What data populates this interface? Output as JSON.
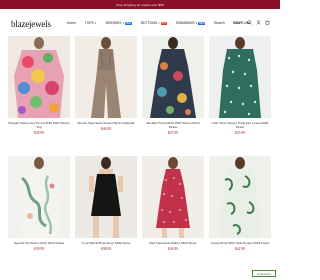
{
  "announcement": "Free shipping on orders over $59",
  "logo": "blazejewels",
  "nav": [
    {
      "label": "Home",
      "caret": false,
      "tag": ""
    },
    {
      "label": "TOPS",
      "caret": true,
      "tag": ""
    },
    {
      "label": "DRESSES",
      "caret": true,
      "tag": "NEW"
    },
    {
      "label": "BOTTOMS",
      "caret": true,
      "tag": "HOT"
    },
    {
      "label": "SWIMWEAR",
      "caret": true,
      "tag": "NEW"
    },
    {
      "label": "Search",
      "caret": false,
      "tag": ""
    },
    {
      "label": "Short Links",
      "caret": false,
      "tag": ""
    }
  ],
  "currency": "USD",
  "products": [
    {
      "title": "Elegant Watercolor Floral Print Half Sleeve Top",
      "price": "$38.99",
      "img": "p1"
    },
    {
      "title": "Brown Sleeveless Round Neck Jumpsuit",
      "price": "$46.99",
      "img": "p2"
    },
    {
      "title": "Modern Floral Print Half Sleeve Maxi Dress",
      "price": "$47.99",
      "img": "p3"
    },
    {
      "title": "Chic Short Sleeve Wide Dot Green Midi Dress",
      "price": "$45.99",
      "img": "p4"
    },
    {
      "title": "Special Tri-Sleeve Print Maxi Dress",
      "price": "$39.99",
      "img": "p5"
    },
    {
      "title": "Cool Black Plain Strap Mini Dress",
      "price": "$38.99",
      "img": "p6"
    },
    {
      "title": "Red Sleeveless Halter Midi Dress",
      "price": "$36.99",
      "img": "p7"
    },
    {
      "title": "Green Plant Print Side Pocket Midi Dress",
      "price": "$42.99",
      "img": "p8"
    }
  ],
  "reviews_label": "Reviews",
  "colors": {
    "announce": "#8a0f27",
    "price": "#a01a1a",
    "accent_new": "#1e6fd9",
    "accent_hot": "#e0392b"
  },
  "icons": [
    "search-icon",
    "user-icon",
    "cart-icon",
    "star-icon"
  ]
}
